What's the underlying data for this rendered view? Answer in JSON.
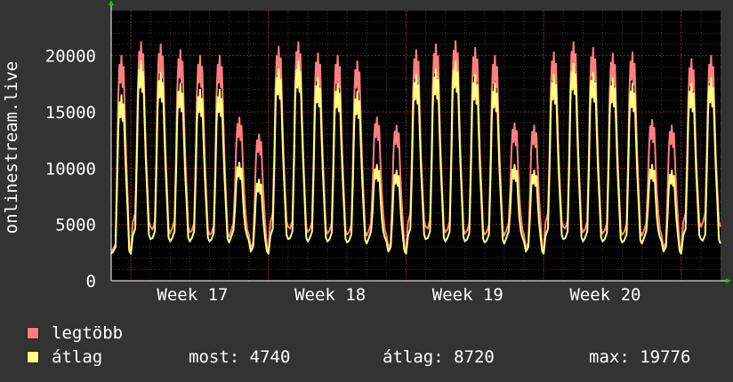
{
  "chart_data": {
    "type": "line",
    "ylabel": "onlinestream.live",
    "ylim": [
      0,
      24000
    ],
    "yticks": [
      0,
      5000,
      10000,
      15000,
      20000
    ],
    "xticks": [
      "Week 17",
      "Week 18",
      "Week 19",
      "Week 20"
    ],
    "grid": true,
    "legend_placement": "bottom-left",
    "series": [
      {
        "name": "legtöbb",
        "color": "#ff7f7f",
        "peaks": [
          20000,
          21200,
          21000,
          20500,
          20000,
          20000,
          14500,
          13000,
          20800,
          21200,
          20200,
          20000,
          19500,
          14500,
          13800,
          20500,
          21000,
          21300,
          20700,
          20000,
          14000,
          13800,
          20300,
          21200,
          20700,
          20200,
          20300,
          14300,
          13800,
          19700,
          20000
        ],
        "troughs": [
          2600,
          4800,
          4200,
          4300,
          4100,
          3900,
          4100,
          2700,
          4800,
          4300,
          4200,
          4100,
          4000,
          4100,
          2700,
          4800,
          4300,
          4200,
          4100,
          4000,
          4100,
          2700,
          4800,
          4300,
          4200,
          4100,
          4000,
          4100,
          2700,
          4800,
          4800
        ]
      },
      {
        "name": "átlag",
        "color": "#ffff80",
        "peaks": [
          16500,
          19500,
          18500,
          17500,
          17000,
          17000,
          10500,
          9000,
          18800,
          19500,
          18000,
          17500,
          16800,
          10300,
          9800,
          18300,
          18800,
          19500,
          18300,
          17500,
          10300,
          9800,
          18300,
          19300,
          18500,
          18000,
          17500,
          10300,
          9800,
          17500,
          18000
        ],
        "troughs": [
          2400,
          3700,
          3500,
          3500,
          3500,
          3400,
          3600,
          2400,
          3700,
          3500,
          3500,
          3400,
          3300,
          3500,
          2400,
          3700,
          3500,
          3500,
          3400,
          3300,
          3500,
          2400,
          3700,
          3500,
          3500,
          3400,
          3300,
          3500,
          2400,
          3700,
          3300
        ]
      }
    ]
  },
  "legend": {
    "items": [
      {
        "label": "legtöbb",
        "color": "#ff7f7f"
      },
      {
        "label": "átlag",
        "color": "#ffff80"
      }
    ],
    "stats": {
      "most": "most: 4740",
      "atlag": "átlag: 8720",
      "max": "max: 19776"
    }
  },
  "colors": {
    "background": "#333333",
    "plot_background": "#000000",
    "grid_minor": "#3a3a3a",
    "grid_major": "#7a2a2a",
    "axis_arrow": "#00cc00"
  }
}
